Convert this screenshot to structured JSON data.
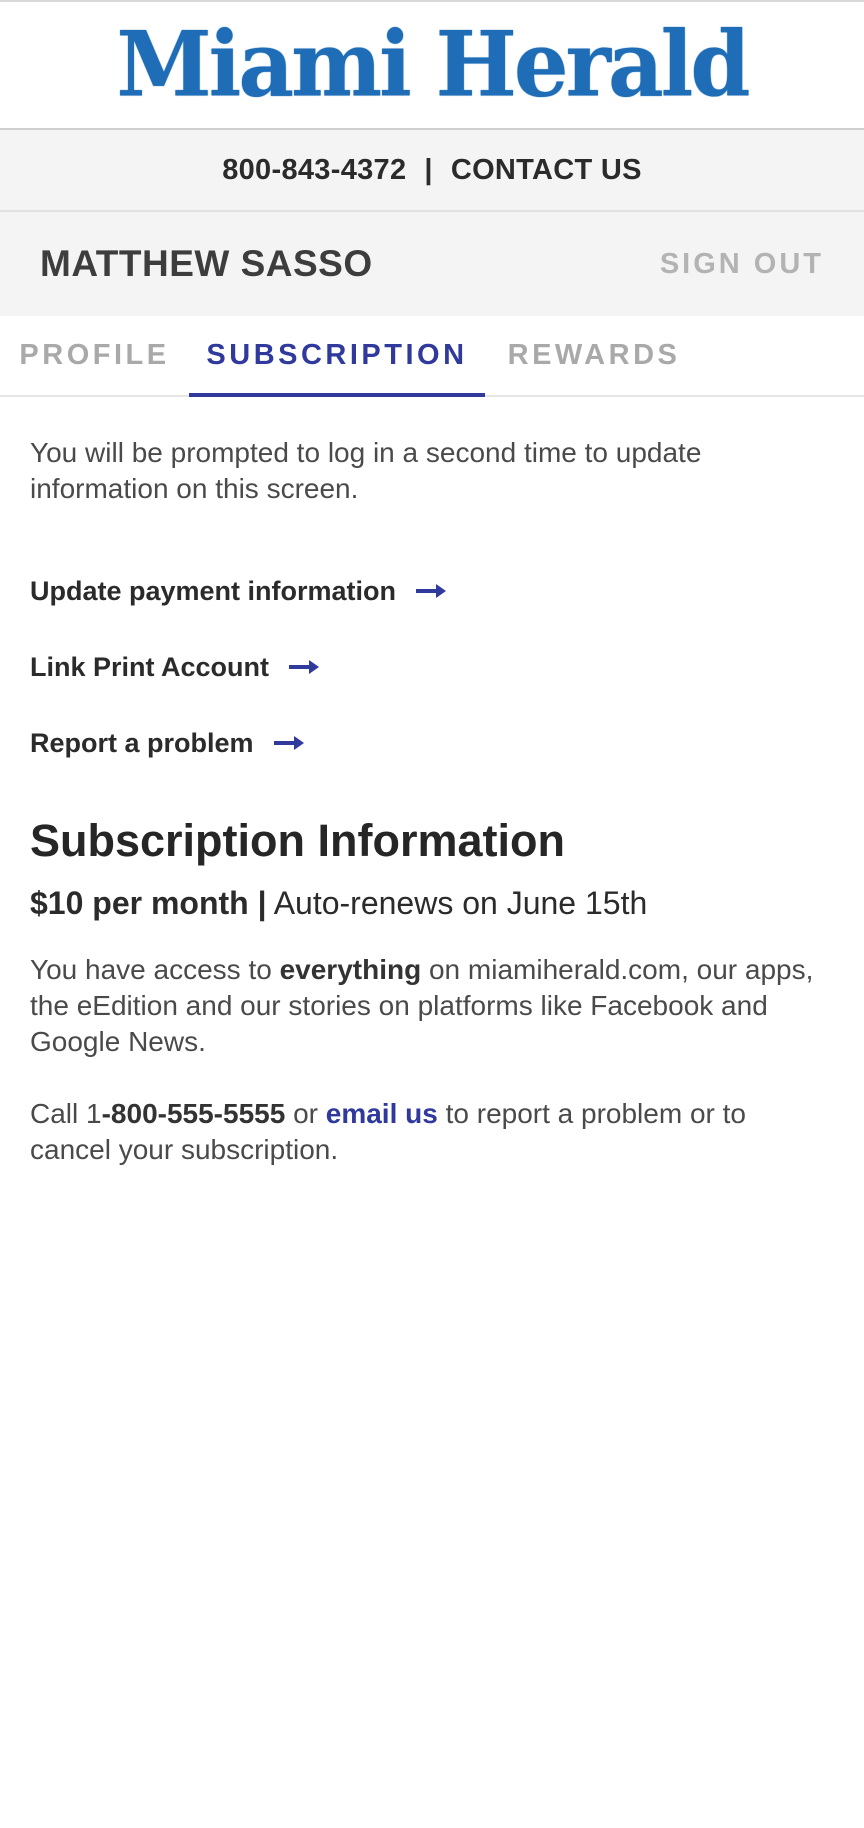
{
  "masthead": {
    "logo_text": "Miami Herald",
    "brand_color": "#1e6db6"
  },
  "contact_bar": {
    "phone": "800-843-4372",
    "separator": "|",
    "contact_label": "CONTACT US"
  },
  "user_bar": {
    "user_name": "MATTHEW SASSO",
    "sign_out_label": "SIGN OUT"
  },
  "tabs": [
    {
      "label": "PROFILE",
      "active": false
    },
    {
      "label": "SUBSCRIPTION",
      "active": true
    },
    {
      "label": "REWARDS",
      "active": false
    }
  ],
  "accent_color": "#2f3a9c",
  "notice": "You will be prompted to log in a second time to update information on this screen.",
  "links": [
    {
      "label": "Update payment information",
      "icon": "arrow-right-icon"
    },
    {
      "label": "Link Print Account",
      "icon": "arrow-right-icon"
    },
    {
      "label": "Report a problem",
      "icon": "arrow-right-icon"
    }
  ],
  "subscription": {
    "title": "Subscription Information",
    "price": "$10 per month |",
    "renewal": "Auto-renews on June 15th",
    "access_prefix": "You have access to ",
    "access_bold": "everything",
    "access_suffix": " on miamiherald.com, our apps, the eEdition and our stories on platforms like Facebook and Google News.",
    "call_prefix": "Call 1",
    "call_phone": "-800-555-5555",
    "call_or": " or ",
    "email_label": "email us",
    "call_suffix": " to report a problem or to cancel your subscription."
  }
}
